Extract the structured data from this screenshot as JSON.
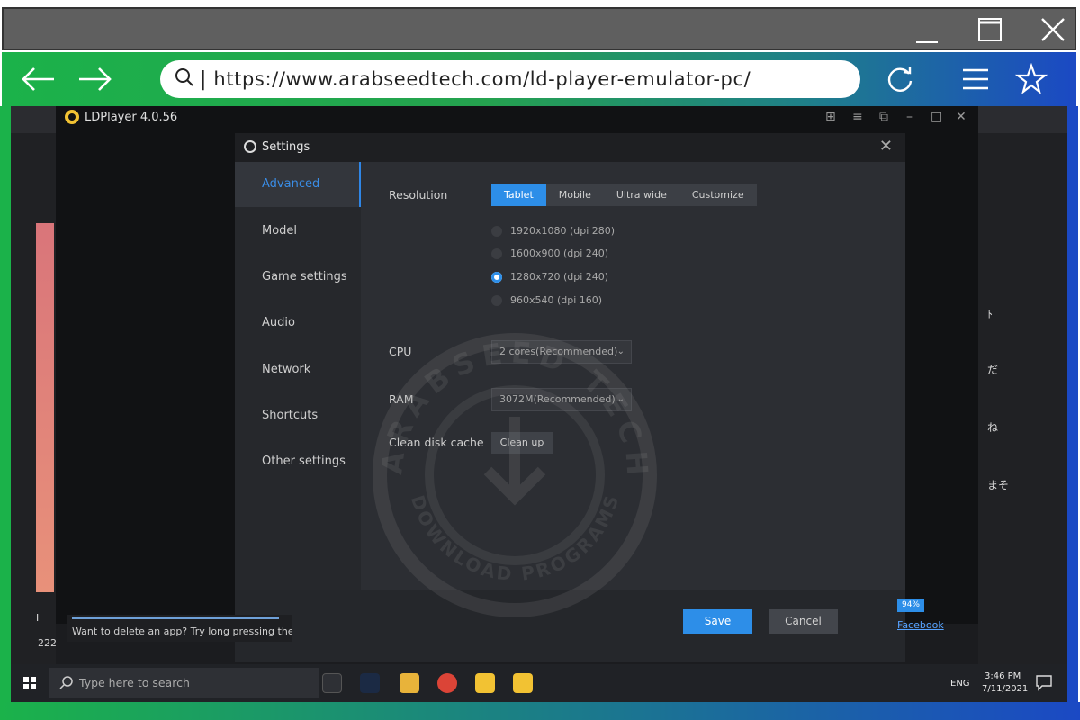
{
  "browser": {
    "url": "https://www.arabseedtech.com/ld-player-emulator-pc/",
    "url_separator": "|"
  },
  "ldplayer": {
    "title": "LDPlayer 4.0.56"
  },
  "settings": {
    "title": "Settings",
    "nav": [
      "Advanced",
      "Model",
      "Game settings",
      "Audio",
      "Network",
      "Shortcuts",
      "Other settings"
    ],
    "active_nav": "Advanced",
    "resolution_label": "Resolution",
    "resolution_tabs": [
      "Tablet",
      "Mobile",
      "Ultra wide",
      "Customize"
    ],
    "active_resolution_tab": "Tablet",
    "resolution_options": [
      "1920x1080  (dpi 280)",
      "1600x900  (dpi 240)",
      "1280x720  (dpi 240)",
      "960x540  (dpi 160)"
    ],
    "selected_resolution": "1280x720  (dpi 240)",
    "cpu_label": "CPU",
    "cpu_value": "2 cores(Recommended)",
    "ram_label": "RAM",
    "ram_value": "3072M(Recommended)",
    "clean_label": "Clean disk cache",
    "clean_button": "Clean up",
    "save_button": "Save",
    "cancel_button": "Cancel"
  },
  "tip": {
    "text": "Want to delete an app? Try long pressing the"
  },
  "download": {
    "percent": "94%",
    "link": "Facebook"
  },
  "watermark": {
    "top_text": "ARABSEED TECH",
    "bottom_text": "DOWNLOAD PROGRAMS"
  },
  "taskbar": {
    "search_placeholder": "Type here to search",
    "language": "ENG",
    "time": "3:46 PM",
    "date": "7/11/2021"
  },
  "side_fragments": {
    "left_count": "222",
    "left_mark": "I",
    "right_chars": [
      "ﾄ",
      "だ",
      "ね",
      "まそ"
    ]
  },
  "colors": {
    "accent": "#2d8ee8",
    "nav_gradient_start": "#1bb24a",
    "nav_gradient_end": "#1b49c4"
  }
}
